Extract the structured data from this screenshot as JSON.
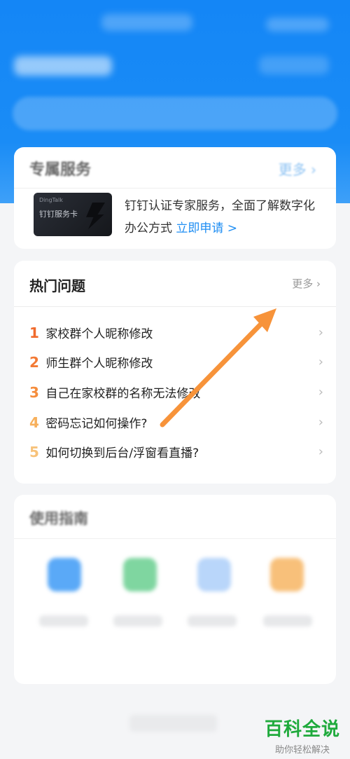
{
  "services": {
    "title": "专属服务",
    "more": "更多",
    "card": {
      "brand": "DingTalk",
      "name": "钉钉服务卡"
    },
    "description": "钉钉认证专家服务，全面了解数字化办公方式",
    "apply_label": "立即申请 >"
  },
  "hot": {
    "title": "热门问题",
    "more": "更多",
    "questions": [
      {
        "num": "1",
        "text": "家校群个人昵称修改",
        "color": "#f06a2c"
      },
      {
        "num": "2",
        "text": "师生群个人昵称修改",
        "color": "#f37a35"
      },
      {
        "num": "3",
        "text": "自己在家校群的名称无法修改",
        "color": "#f58d3c"
      },
      {
        "num": "4",
        "text": "密码忘记如何操作?",
        "color": "#f7b05c"
      },
      {
        "num": "5",
        "text": "如何切换到后台/浮窗看直播?",
        "color": "#f7c27a"
      }
    ]
  },
  "guide": {
    "title": "使用指南",
    "icons": [
      {
        "name": "blue-doc-icon",
        "color": "#5aa9f7"
      },
      {
        "name": "green-video-icon",
        "color": "#7fd6a0"
      },
      {
        "name": "code-icon",
        "color": "#8dbcf5"
      },
      {
        "name": "orange-shield-icon",
        "color": "#f8c07a"
      }
    ]
  },
  "colors": {
    "header_blue": "#1486f6",
    "accent_link": "#1f8ef3",
    "arrow_orange": "#f7933a"
  },
  "watermark": {
    "title": "百科全说",
    "subtitle": "助你轻松解决"
  }
}
